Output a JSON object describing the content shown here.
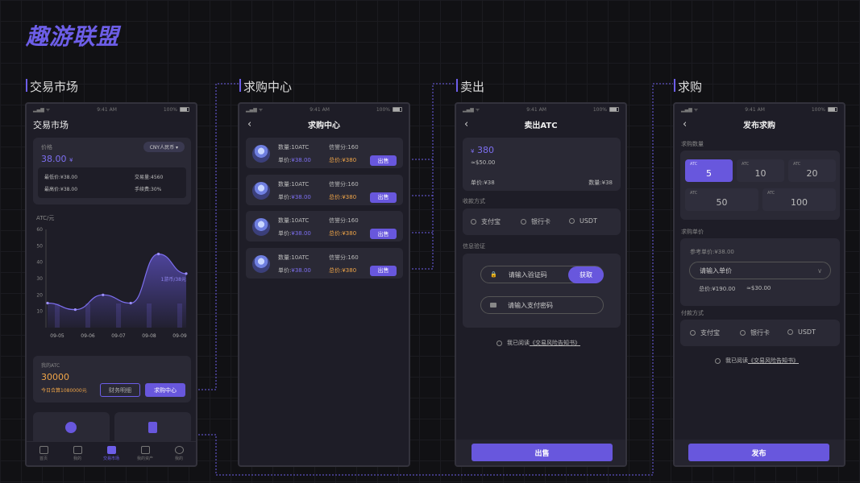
{
  "brand": "趣游联盟",
  "sections": [
    "交易市场",
    "求购中心",
    "卖出",
    "求购"
  ],
  "status": {
    "time": "9:41 AM",
    "battery": "100%"
  },
  "market": {
    "title": "交易市场",
    "price_label": "价格",
    "price": "38.00",
    "price_unit": "¥",
    "currency": "CNY人民币 ▾",
    "low_label": "最低价:¥38.00",
    "volume_label": "交易量:4560",
    "high_label": "最高价:¥38.00",
    "fee_label": "手续费:30%",
    "chart_unit": "ATC/元",
    "my_atc_label": "我的ATC",
    "my_atc": "30000",
    "today_label": "今日合算1080000元",
    "detail_btn": "财务明细",
    "buy_btn": "求购中心",
    "tabs": [
      "首页",
      "我的",
      "交易市场",
      "我的资产",
      "我的"
    ]
  },
  "chart_data": {
    "type": "area",
    "x": [
      "09-05",
      "09-06",
      "09-07",
      "09-08",
      "09-09"
    ],
    "yticks": [
      10,
      20,
      30,
      40,
      50,
      60
    ],
    "ylim": [
      0,
      60
    ],
    "series": [
      {
        "values": [
          15,
          11,
          20,
          15,
          45,
          33
        ]
      }
    ],
    "annotation": "1游币/38元",
    "ylabel": "ATC/元"
  },
  "buy_center": {
    "title": "求购中心",
    "items": [
      {
        "qty": "数量:10ATC",
        "score": "信誉分:160",
        "unit": "单价:",
        "unit_val": "¥38.00",
        "total": "总价:¥380",
        "btn": "出售"
      },
      {
        "qty": "数量:10ATC",
        "score": "信誉分:160",
        "unit": "单价:",
        "unit_val": "¥38.00",
        "total": "总价:¥380",
        "btn": "出售"
      },
      {
        "qty": "数量:10ATC",
        "score": "信誉分:160",
        "unit": "单价:",
        "unit_val": "¥38.00",
        "total": "总价:¥380",
        "btn": "出售"
      },
      {
        "qty": "数量:10ATC",
        "score": "信誉分:160",
        "unit": "单价:",
        "unit_val": "¥38.00",
        "total": "总价:¥380",
        "btn": "出售"
      }
    ]
  },
  "sell": {
    "title": "卖出ATC",
    "amount": "380",
    "amount_unit": "¥",
    "approx": "≈$50.00",
    "unit_price": "单价:¥38",
    "qty": "数量:¥38",
    "pay_label": "收款方式",
    "pay": [
      "支付宝",
      "银行卡",
      "USDT"
    ],
    "verify_label": "信息验证",
    "code_ph": "请输入验证码",
    "get_btn": "获取",
    "pwd_ph": "请输入支付密码",
    "agree": "我已阅读",
    "agree_link": "《交易风险告知书》",
    "submit": "出售"
  },
  "post": {
    "title": "发布求购",
    "qty_label": "求购数量",
    "opts": [
      {
        "s": "ATC",
        "v": "5"
      },
      {
        "s": "ATC",
        "v": "10"
      },
      {
        "s": "ATC",
        "v": "20"
      },
      {
        "s": "ATC",
        "v": "50"
      },
      {
        "s": "ATC",
        "v": "100"
      }
    ],
    "price_label": "求购单价",
    "ref": "参考单价:¥38.00",
    "price_ph": "请输入单价",
    "total": "总价:¥190.00",
    "approx": "≈$30.00",
    "pay_label": "付款方式",
    "pay": [
      "支付宝",
      "银行卡",
      "USDT"
    ],
    "agree": "我已阅读",
    "agree_link": "《交易风险告知书》",
    "submit": "发布"
  }
}
